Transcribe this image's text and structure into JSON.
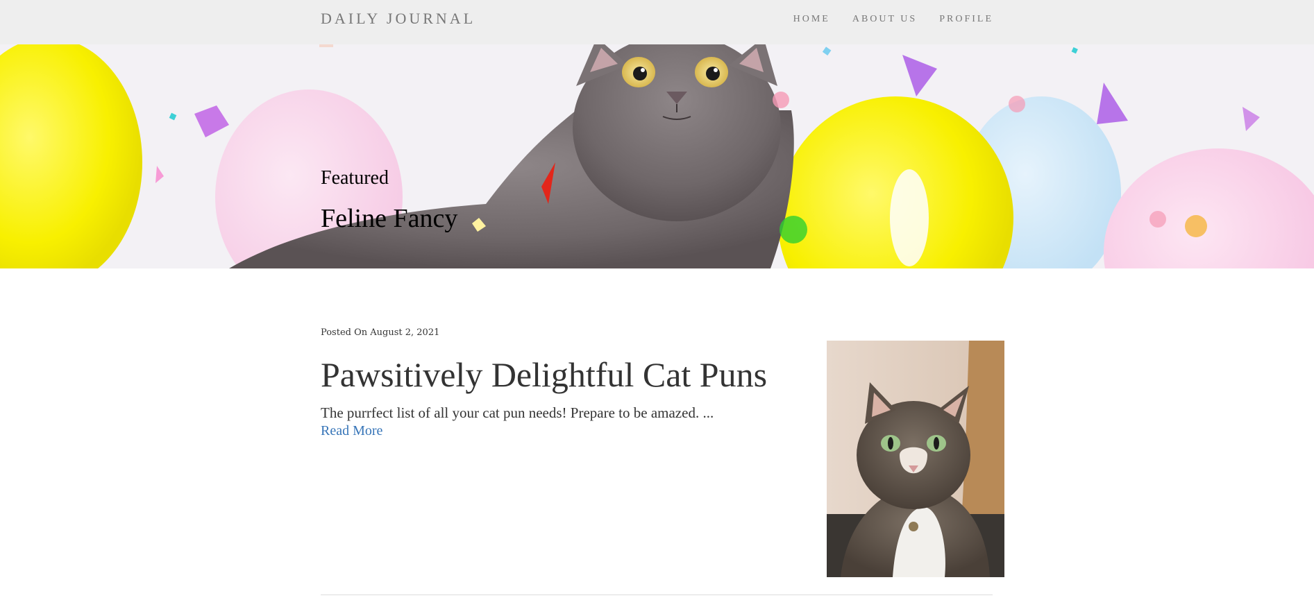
{
  "nav": {
    "brand": "DAILY JOURNAL",
    "links": [
      "HOME",
      "ABOUT US",
      "PROFILE"
    ]
  },
  "hero": {
    "kicker": "Featured",
    "title": "Feline Fancy",
    "image": "cat-with-balloons-and-confetti"
  },
  "post": {
    "meta": "Posted On August 2, 2021",
    "title": "Pawsitively Delightful Cat Puns",
    "excerpt": "The purrfect list of all your cat pun needs! Prepare to be amazed. ...",
    "read_more": "Read More",
    "image": "tabby-cat-photo"
  },
  "colors": {
    "navbar_bg": "#eeeeee",
    "nav_text": "#777777",
    "link": "#3775b8",
    "body_text": "#333333"
  }
}
